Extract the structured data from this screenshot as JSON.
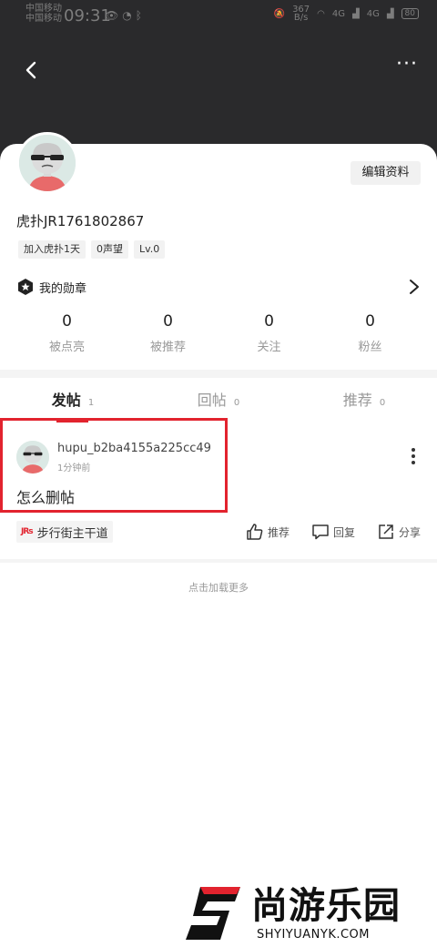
{
  "status_bar": {
    "carrier_top": "中国移动",
    "carrier_bottom": "中国移动",
    "time": "09:31",
    "net_speed_value": "367",
    "net_speed_unit": "B/s",
    "signal_label_1": "4G",
    "signal_label_2": "4G",
    "battery": "80"
  },
  "header": {
    "back_icon": "chevron-left-icon",
    "more_icon": "more-dots-icon",
    "more_glyph": "···"
  },
  "profile": {
    "edit_button": "编辑资料",
    "username": "虎扑JR1761802867",
    "tags": [
      "加入虎扑1天",
      "0声望",
      "Lv.0"
    ],
    "medal_label": "我的勋章",
    "stats": [
      {
        "value": "0",
        "label": "被点亮"
      },
      {
        "value": "0",
        "label": "被推荐"
      },
      {
        "value": "0",
        "label": "关注"
      },
      {
        "value": "0",
        "label": "粉丝"
      }
    ]
  },
  "tabs": [
    {
      "label": "发帖",
      "count": "1",
      "active": true
    },
    {
      "label": "回帖",
      "count": "0",
      "active": false
    },
    {
      "label": "推荐",
      "count": "0",
      "active": false
    }
  ],
  "post": {
    "author": "hupu_b2ba4155a225cc49",
    "time": "1分钟前",
    "title": "怎么删帖",
    "forum_logo": "JRs",
    "forum_name": "步行街主干道",
    "actions": [
      {
        "icon": "thumbs-up-icon",
        "label": "推荐"
      },
      {
        "icon": "comment-icon",
        "label": "回复"
      },
      {
        "icon": "share-icon",
        "label": "分享"
      }
    ]
  },
  "load_more": "点击加载更多",
  "watermark": {
    "text": "尚游乐园",
    "url": "SHYIYUANYK.COM"
  },
  "colors": {
    "accent": "#e2232e",
    "header_bg": "#2a2a2c"
  }
}
